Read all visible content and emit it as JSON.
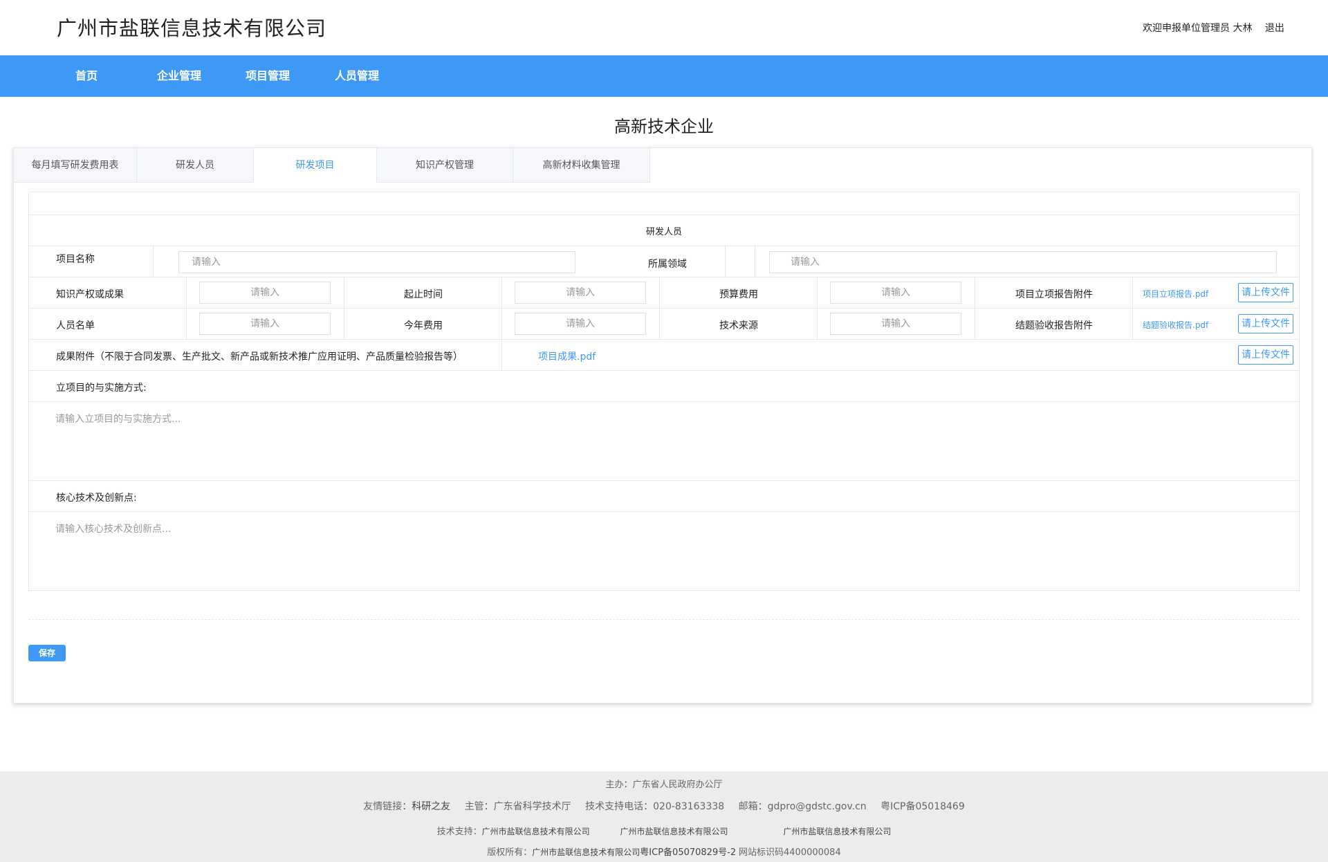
{
  "header": {
    "company_name": "广州市盐联信息技术有限公司",
    "welcome_text": "欢迎申报单位管理员 大林",
    "logout_label": "退出"
  },
  "nav": {
    "items": [
      {
        "label": "首页"
      },
      {
        "label": "企业管理"
      },
      {
        "label": "项目管理"
      },
      {
        "label": "人员管理"
      }
    ]
  },
  "page_title": "高新技术企业",
  "tabs": [
    {
      "label": "每月填写研发费用表",
      "active": false
    },
    {
      "label": "研发人员",
      "active": false
    },
    {
      "label": "研发项目",
      "active": true
    },
    {
      "label": "知识产权管理",
      "active": false
    },
    {
      "label": "高新材料收集管理",
      "active": false
    }
  ],
  "form": {
    "section_title": "研发人员",
    "project_name_label": "项目名称",
    "project_name_placeholder": "请输入",
    "field_label": "所属领域",
    "field_placeholder": "请输入",
    "ip_label": "知识产权或成果",
    "ip_placeholder": "请输入",
    "period_label": "起止时间",
    "period_placeholder": "请输入",
    "budget_label": "预算费用",
    "budget_placeholder": "请输入",
    "approval_attach_label": "项目立项报告附件",
    "approval_attach_file": "项目立项报告.pdf",
    "staff_label": "人员名单",
    "staff_placeholder": "请输入",
    "year_cost_label": "今年费用",
    "year_cost_placeholder": "请输入",
    "tech_source_label": "技术来源",
    "tech_source_placeholder": "请输入",
    "acceptance_attach_label": "结题验收报告附件",
    "acceptance_attach_file": "结题验收报告.pdf",
    "result_attach_label": "成果附件（不限于合同发票、生产批文、新产品或新技术推广应用证明、产品质量检验报告等）",
    "result_attach_file": "项目成果.pdf",
    "upload_label": "请上传文件",
    "purpose_label": "立项目的与实施方式:",
    "purpose_placeholder": "请输入立项目的与实施方式...",
    "core_label": "核心技术及创新点:",
    "core_placeholder": "请输入核心技术及创新点...",
    "save_label": "保存"
  },
  "footer": {
    "line1": "主办：广东省人民政府办公厅",
    "line2_links_label": "友情链接：",
    "line2_link": "科研之友",
    "line2_host": "主管：广东省科学技术厅",
    "line2_phone": "技术支持电话：020-83163338",
    "line2_email": "邮箱：gdpro@gdstc.gov.cn",
    "line2_icp": "粤ICP备05018469",
    "line3_label": "技术支持：",
    "line3_company1": "广州市盐联信息技术有限公司",
    "line3_company2": "广州市盐联信息技术有限公司",
    "line3_company3": "广州市盐联信息技术有限公司",
    "line4_label": "版权所有：",
    "line4_company": "广州市盐联信息技术有限公司",
    "line4_icp": "粤ICP备05070829号-2",
    "line4_site": "网站标识码4400000084"
  }
}
